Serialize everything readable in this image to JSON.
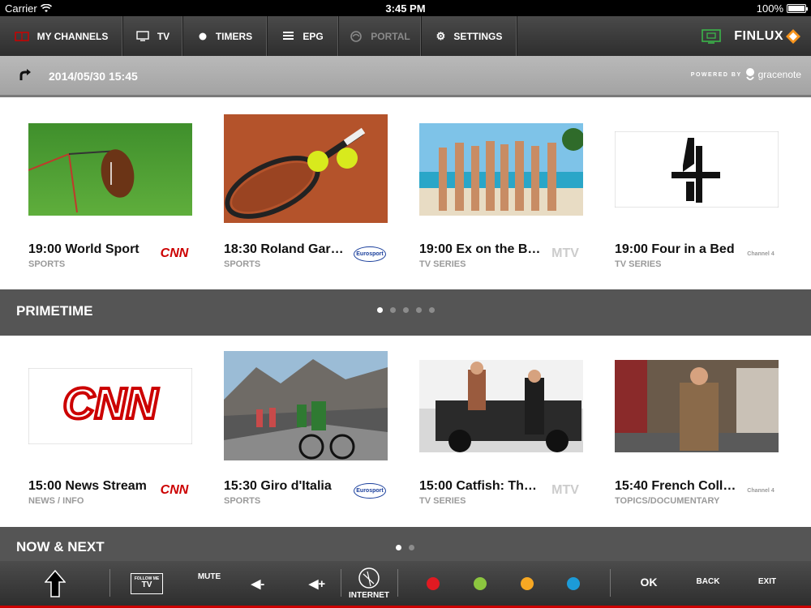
{
  "status_bar": {
    "carrier": "Carrier",
    "time": "3:45 PM",
    "battery": "100%"
  },
  "nav": {
    "items": [
      {
        "label": "MY CHANNELS",
        "icon": "my-channels-icon",
        "active": true
      },
      {
        "label": "TV",
        "icon": "tv-icon"
      },
      {
        "label": "TIMERS",
        "icon": "timers-icon"
      },
      {
        "label": "EPG",
        "icon": "epg-icon"
      },
      {
        "label": "PORTAL",
        "icon": "portal-icon",
        "disabled": true
      },
      {
        "label": "SETTINGS",
        "icon": "gear-icon"
      }
    ],
    "brand": "FINLUX"
  },
  "date_bar": {
    "date": "2014/05/30 15:45",
    "powered_by": "POWERED BY",
    "provider": "gracenote"
  },
  "rows": [
    {
      "cards": [
        {
          "title": "19:00 World Sport",
          "category": "SPORTS",
          "channel": "CNN",
          "image": "american-football-on-grass"
        },
        {
          "title": "18:30 Roland Garr…",
          "category": "SPORTS",
          "channel": "Eurosport",
          "image": "tennis-racket-on-clay"
        },
        {
          "title": "19:00 Ex on the B…",
          "category": "TV SERIES",
          "channel": "MTV",
          "image": "group-on-beach"
        },
        {
          "title": "19:00 Four in a Bed",
          "category": "TV SERIES",
          "channel": "Channel 4",
          "image": "channel-4-logo"
        }
      ]
    },
    {
      "cards": [
        {
          "title": "15:00 News Stream",
          "category": "NEWS / INFO",
          "channel": "CNN",
          "image": "cnn-logo"
        },
        {
          "title": "15:30 Giro d'Italia",
          "category": "SPORTS",
          "channel": "Eurosport",
          "image": "cyclists-mountain-road"
        },
        {
          "title": "15:00 Catfish: The…",
          "category": "TV SERIES",
          "channel": "MTV",
          "image": "two-men-on-jeep"
        },
        {
          "title": "15:40 French Coll…",
          "category": "TOPICS/DOCUMENTARY",
          "channel": "Channel 4",
          "image": "man-in-street"
        }
      ]
    }
  ],
  "sections": [
    {
      "title": "PRIMETIME",
      "pages": 5,
      "current": 0
    },
    {
      "title": "NOW & NEXT",
      "pages": 2,
      "current": 0
    }
  ],
  "bottom_bar": {
    "follow_me_top": "FOLLOW ME",
    "follow_me_bottom": "TV",
    "mute": "MUTE",
    "internet": "INTERNET",
    "ok": "OK",
    "back": "BACK",
    "exit": "EXIT",
    "colors": [
      "#e01a22",
      "#8cc63f",
      "#f7a823",
      "#1c9bd8"
    ]
  },
  "colors": {
    "accent_red": "#cc0000",
    "nav_bg": "#3a3a3a",
    "section_bg": "#555555"
  }
}
